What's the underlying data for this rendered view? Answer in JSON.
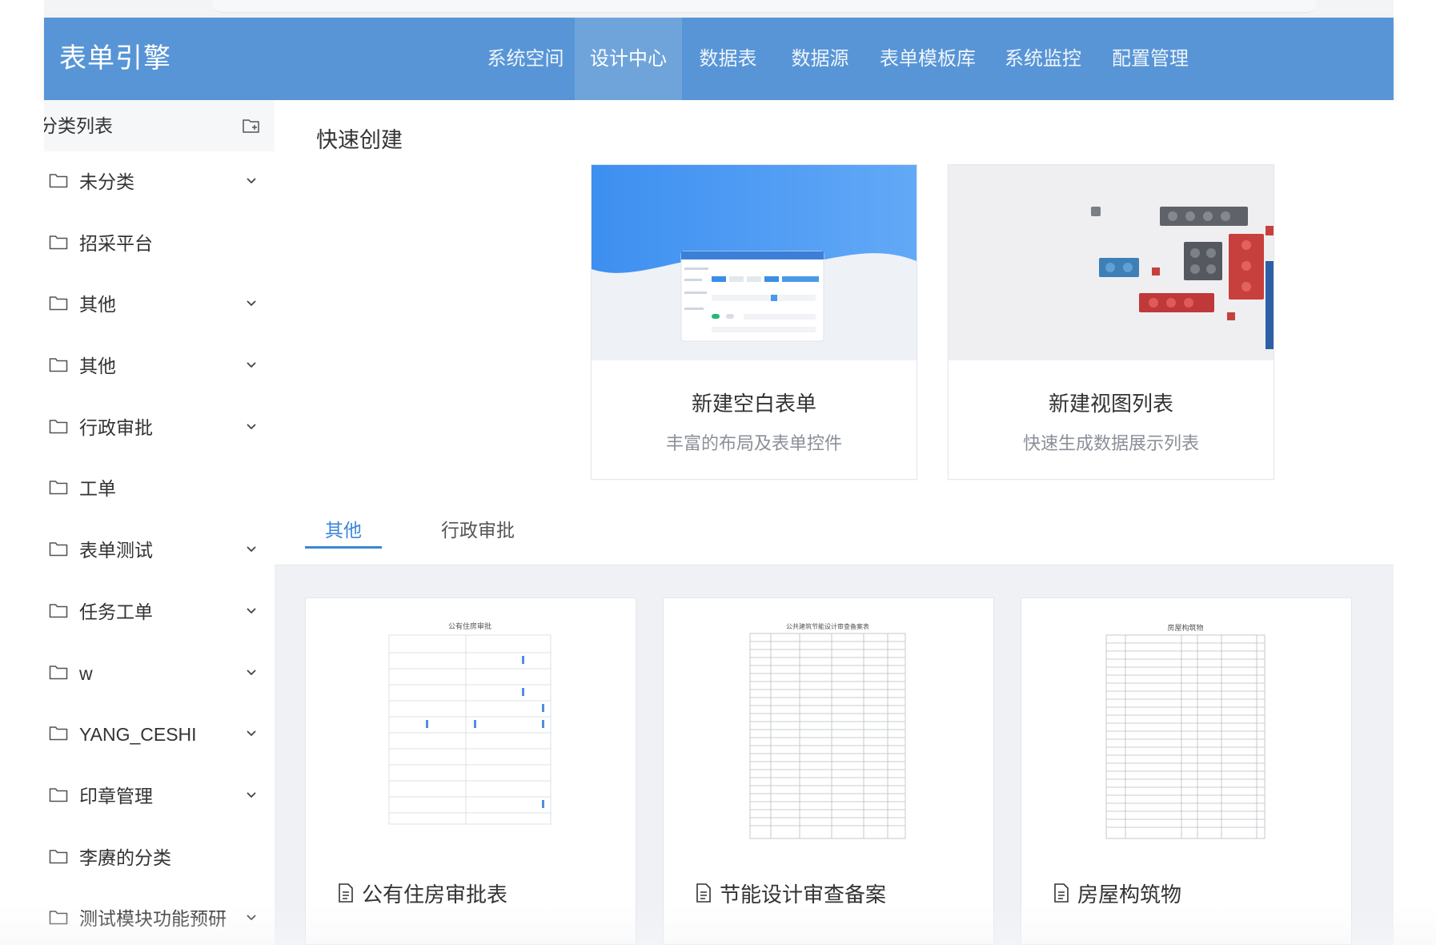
{
  "header": {
    "brand": "表单引擎",
    "nav": [
      {
        "label": "系统空间",
        "active": false
      },
      {
        "label": "设计中心",
        "active": true
      },
      {
        "label": "数据表",
        "active": false
      },
      {
        "label": "数据源",
        "active": false
      },
      {
        "label": "表单模板库",
        "active": false
      },
      {
        "label": "系统监控",
        "active": false
      },
      {
        "label": "配置管理",
        "active": false
      }
    ]
  },
  "sidebar": {
    "title": "分类列表",
    "add_icon": "add-folder-icon",
    "items": [
      {
        "label": "未分类",
        "expandable": true
      },
      {
        "label": "招采平台",
        "expandable": false
      },
      {
        "label": "其他",
        "expandable": true
      },
      {
        "label": "其他",
        "expandable": true
      },
      {
        "label": "行政审批",
        "expandable": true
      },
      {
        "label": "工单",
        "expandable": false
      },
      {
        "label": "表单测试",
        "expandable": true
      },
      {
        "label": "任务工单",
        "expandable": true
      },
      {
        "label": "w",
        "expandable": true
      },
      {
        "label": "YANG_CESHI",
        "expandable": true
      },
      {
        "label": "印章管理",
        "expandable": true
      },
      {
        "label": "李赓的分类",
        "expandable": false
      },
      {
        "label": "测试模块功能预研",
        "expandable": true
      }
    ]
  },
  "main": {
    "quick_create": {
      "title": "快速创建",
      "cards": [
        {
          "name": "新建空白表单",
          "desc": "丰富的布局及表单控件"
        },
        {
          "name": "新建视图列表",
          "desc": "快速生成数据展示列表"
        }
      ]
    },
    "tabs": [
      {
        "label": "其他",
        "active": true
      },
      {
        "label": "行政审批",
        "active": false
      }
    ],
    "templates": [
      {
        "name": "公有住房审批表",
        "doc_title": "公有住房审批"
      },
      {
        "name": "节能设计审查备案",
        "doc_title": "公共建筑节能设计审查备案表"
      },
      {
        "name": "房屋构筑物",
        "doc_title": "房屋构筑物"
      }
    ]
  },
  "colors": {
    "header_bg": "#5895d6",
    "accent": "#3a86d8",
    "template_area_bg": "#eff1f5"
  }
}
